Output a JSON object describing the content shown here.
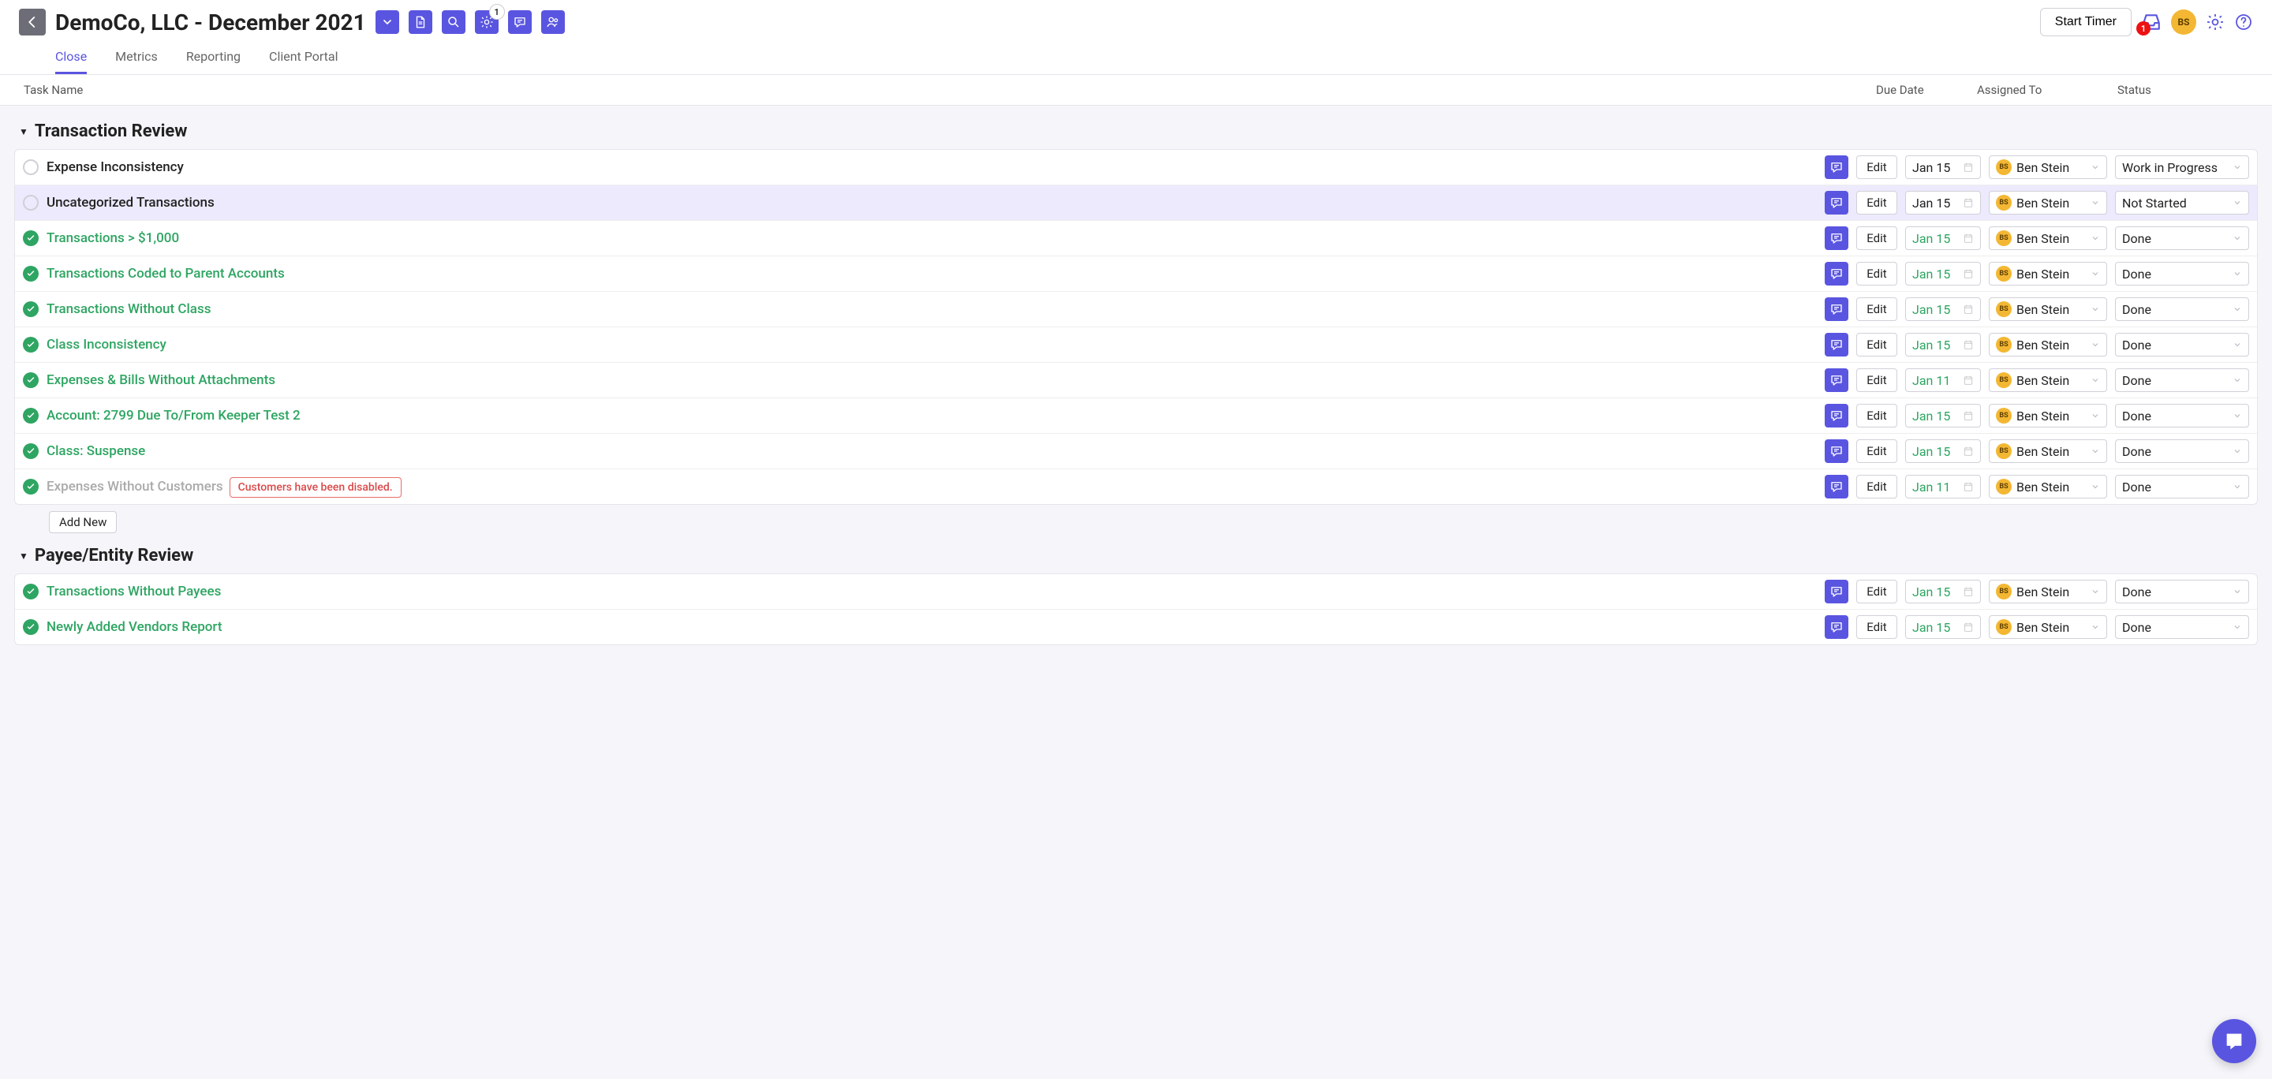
{
  "header": {
    "title": "DemoCo, LLC - December 2021",
    "badge_count": "1",
    "start_timer": "Start Timer",
    "inbox_badge": "1",
    "avatar": "BS",
    "tabs": [
      "Close",
      "Metrics",
      "Reporting",
      "Client Portal"
    ]
  },
  "columns": {
    "task": "Task Name",
    "due": "Due Date",
    "assigned": "Assigned To",
    "status": "Status"
  },
  "assignee": {
    "initials": "BS",
    "name": "Ben Stein"
  },
  "statuses": {
    "wip": "Work in Progress",
    "ns": "Not Started",
    "done": "Done"
  },
  "buttons": {
    "edit": "Edit",
    "add_new": "Add New"
  },
  "sections": [
    {
      "title": "Transaction Review",
      "tasks": [
        {
          "name": "Expense Inconsistency",
          "due": "Jan 15",
          "status": "wip",
          "done": false,
          "highlight": false
        },
        {
          "name": "Uncategorized Transactions",
          "due": "Jan 15",
          "status": "ns",
          "done": false,
          "highlight": true
        },
        {
          "name": "Transactions > $1,000",
          "due": "Jan 15",
          "status": "done",
          "done": true
        },
        {
          "name": "Transactions Coded to Parent Accounts",
          "due": "Jan 15",
          "status": "done",
          "done": true
        },
        {
          "name": "Transactions Without Class",
          "due": "Jan 15",
          "status": "done",
          "done": true
        },
        {
          "name": "Class Inconsistency",
          "due": "Jan 15",
          "status": "done",
          "done": true
        },
        {
          "name": "Expenses & Bills Without Attachments",
          "due": "Jan 11",
          "status": "done",
          "done": true
        },
        {
          "name": "Account: 2799 Due To/From Keeper Test 2",
          "due": "Jan 15",
          "status": "done",
          "done": true
        },
        {
          "name": "Class: Suspense",
          "due": "Jan 15",
          "status": "done",
          "done": true
        },
        {
          "name": "Expenses Without Customers",
          "due": "Jan 11",
          "status": "done",
          "done": true,
          "dim": true,
          "warn": "Customers have been disabled."
        }
      ],
      "show_add": true
    },
    {
      "title": "Payee/Entity Review",
      "tasks": [
        {
          "name": "Transactions Without Payees",
          "due": "Jan 15",
          "status": "done",
          "done": true
        },
        {
          "name": "Newly Added Vendors Report",
          "due": "Jan 15",
          "status": "done",
          "done": true
        }
      ],
      "show_add": false
    }
  ]
}
